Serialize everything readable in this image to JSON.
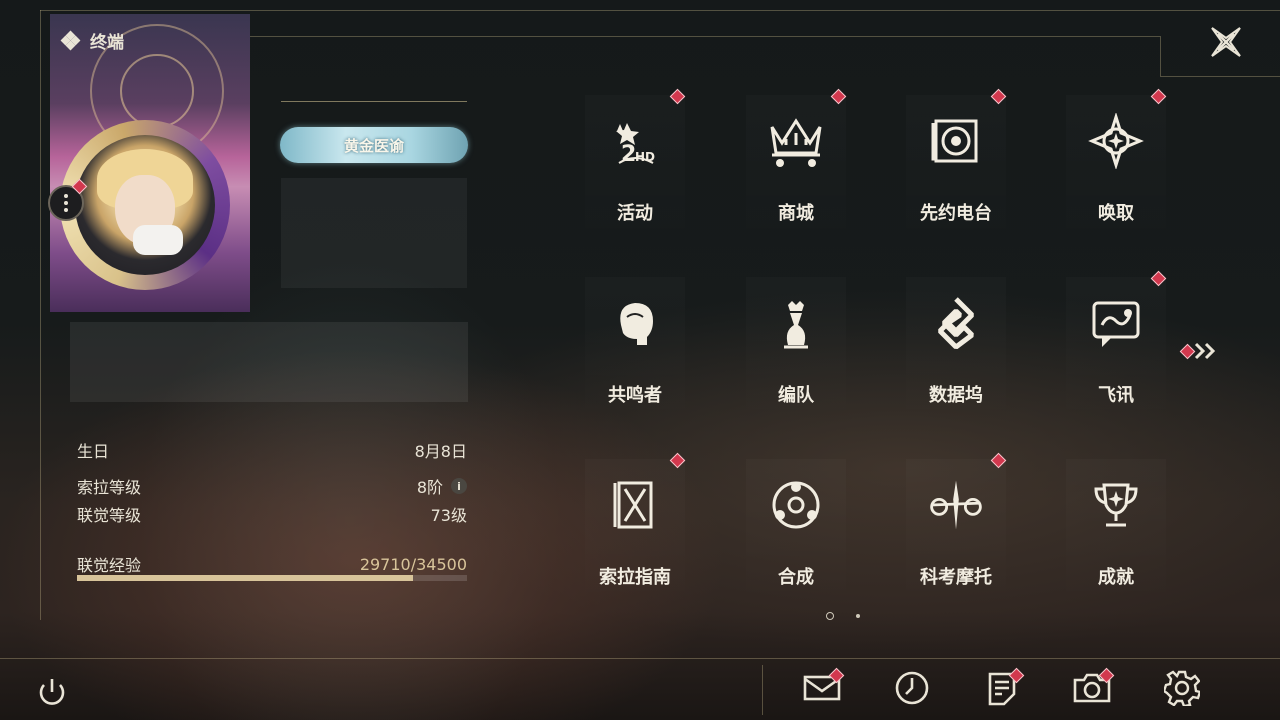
{
  "header": {
    "title": "终端"
  },
  "profile": {
    "title_badge": "黄金医谕",
    "stats": [
      {
        "label": "生日",
        "value": "8月8日"
      },
      {
        "label": "索拉等级",
        "value": "8阶"
      },
      {
        "label": "联觉等级",
        "value": "73级"
      }
    ],
    "exp": {
      "label": "联觉经验",
      "value": "29710/34500",
      "fraction": 0.861
    }
  },
  "menu": [
    {
      "label": "活动",
      "icon": "event-icon",
      "badge": true
    },
    {
      "label": "商城",
      "icon": "shop-crown-icon",
      "badge": true
    },
    {
      "label": "先约电台",
      "icon": "radio-icon",
      "badge": true
    },
    {
      "label": "唤取",
      "icon": "summon-star-icon",
      "badge": true
    },
    {
      "label": "共鸣者",
      "icon": "resonator-head-icon",
      "badge": false
    },
    {
      "label": "编队",
      "icon": "chess-team-icon",
      "badge": false
    },
    {
      "label": "数据坞",
      "icon": "data-dock-icon",
      "badge": false
    },
    {
      "label": "飞讯",
      "icon": "message-icon",
      "badge": true
    },
    {
      "label": "索拉指南",
      "icon": "guide-icon",
      "badge": true
    },
    {
      "label": "合成",
      "icon": "synthesis-icon",
      "badge": false
    },
    {
      "label": "科考摩托",
      "icon": "motorcycle-icon",
      "badge": true
    },
    {
      "label": "成就",
      "icon": "trophy-icon",
      "badge": false
    }
  ],
  "pagination": {
    "pages": 2,
    "current": 1
  },
  "bottom_bar": [
    {
      "icon": "mail-icon",
      "badge": true
    },
    {
      "icon": "clock-icon",
      "badge": false
    },
    {
      "icon": "notice-icon",
      "badge": true
    },
    {
      "icon": "camera-icon",
      "badge": true
    },
    {
      "icon": "gear-icon",
      "badge": false
    }
  ],
  "colors": {
    "badge": "#d2384e",
    "gold": "#d8c49a",
    "text": "#e9e4d6"
  }
}
